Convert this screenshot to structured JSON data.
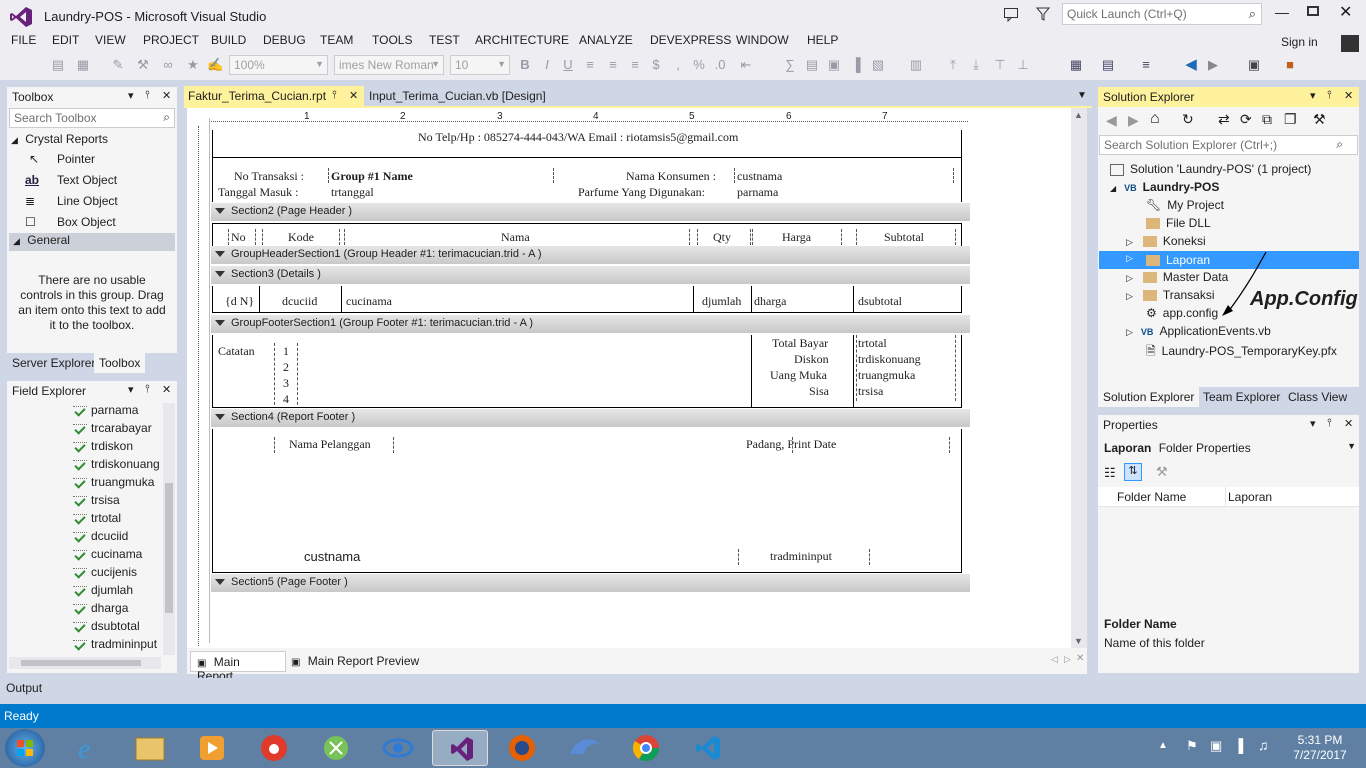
{
  "title": "Laundry-POS - Microsoft Visual Studio",
  "quick_launch": "Quick Launch (Ctrl+Q)",
  "sign_in": "Sign in",
  "menu": [
    "FILE",
    "EDIT",
    "VIEW",
    "PROJECT",
    "BUILD",
    "DEBUG",
    "TEAM",
    "TOOLS",
    "TEST",
    "ARCHITECTURE",
    "ANALYZE",
    "DEVEXPRESS",
    "WINDOW",
    "HELP"
  ],
  "toolbar": {
    "zoom": "100%",
    "font": "imes New Roman",
    "size": "10"
  },
  "toolbox": {
    "title": "Toolbox",
    "search": "Search Toolbox",
    "group1": "Crystal Reports",
    "items": [
      "Pointer",
      "Text Object",
      "Line Object",
      "Box Object"
    ],
    "group2": "General",
    "empty_msg": "There are no usable controls in this group. Drag an item onto this text to add it to the toolbox.",
    "tabs": [
      "Server Explorer",
      "Toolbox"
    ]
  },
  "field_explorer": {
    "title": "Field Explorer",
    "items": [
      "parnama",
      "trcarabayar",
      "trdiskon",
      "trdiskonuang",
      "truangmuka",
      "trsisa",
      "trtotal",
      "dcuciid",
      "cucinama",
      "cucijenis",
      "djumlah",
      "dharga",
      "dsubtotal",
      "tradmininput"
    ]
  },
  "doc_tabs": [
    "Faktur_Terima_Cucian.rpt",
    "Input_Terima_Cucian.vb [Design]"
  ],
  "ruler": [
    "1",
    "2",
    "3",
    "4",
    "5",
    "6",
    "7"
  ],
  "report": {
    "header_line": "No Telp/Hp : 085274-444-043/WA Email : riotamsis5@gmail.com",
    "no_transaksi_lbl": "No Transaksi :",
    "group1_name": "Group #1 Name",
    "nama_konsumen_lbl": "Nama Konsumen :",
    "custnama": "custnama",
    "tanggal_masuk_lbl": "Tanggal Masuk :",
    "trtanggal": "trtanggal",
    "parfume_lbl": "Parfume Yang Digunakan:",
    "parnama": "parnama",
    "section2": "Section2 (Page Header )",
    "col_no": "No",
    "col_kode": "Kode",
    "col_nama": "Nama",
    "col_qty": "Qty",
    "col_harga": "Harga",
    "col_subtotal": "Subtotal",
    "group_header": "GroupHeaderSection1 (Group Header #1: terimacucian.trid - A )",
    "section3": "Section3 (Details  )",
    "d_no": "{d N}",
    "d_kode": "dcuciid",
    "d_nama": "cucinama",
    "d_qty": "djumlah",
    "d_harga": "dharga",
    "d_subtotal": "dsubtotal",
    "group_footer": "GroupFooterSection1 (Group Footer #1: terimacucian.trid - A )",
    "catatan": "Catatan",
    "notes": [
      "1",
      "2",
      "3",
      "4"
    ],
    "total_bayar": "Total Bayar",
    "diskon": "Diskon",
    "uang_muka": "Uang Muka",
    "sisa": "Sisa",
    "trtotal": "trtotal",
    "trdiskonuang": "trdiskonuang",
    "truangmuka": "truangmuka",
    "trsisa": "trsisa",
    "section4": "Section4 (Report Footer  )",
    "nama_pelanggan": "Nama Pelanggan",
    "padang_print": "Padang, Print Date",
    "footer_custnama": "custnama",
    "footer_admin": "tradmininput",
    "section5": "Section5 (Page Footer  )"
  },
  "bottom_tabs": [
    "Main Report",
    "Main Report Preview"
  ],
  "solution_explorer": {
    "title": "Solution Explorer",
    "search": "Search Solution Explorer (Ctrl+;)",
    "solution": "Solution 'Laundry-POS' (1 project)",
    "project": "Laundry-POS",
    "items": [
      "My Project",
      "File DLL",
      "Koneksi",
      "Laporan",
      "Master Data",
      "Transaksi",
      "app.config",
      "ApplicationEvents.vb",
      "Laundry-POS_TemporaryKey.pfx"
    ],
    "annotation": "App.Config",
    "tabs": [
      "Solution Explorer",
      "Team Explorer",
      "Class View"
    ]
  },
  "properties": {
    "title": "Properties",
    "object": "Laporan",
    "object_type": "Folder Properties",
    "prop_name": "Folder Name",
    "prop_value": "Laporan",
    "desc_title": "Folder Name",
    "desc_text": "Name of this folder"
  },
  "output_label": "Output",
  "status": "Ready",
  "clock": {
    "time": "5:31 PM",
    "date": "7/27/2017"
  },
  "colors": {
    "accent": "#007acc",
    "highlight": "#3399ff",
    "active_header": "#fff29d",
    "vs_purple": "#68217a"
  }
}
